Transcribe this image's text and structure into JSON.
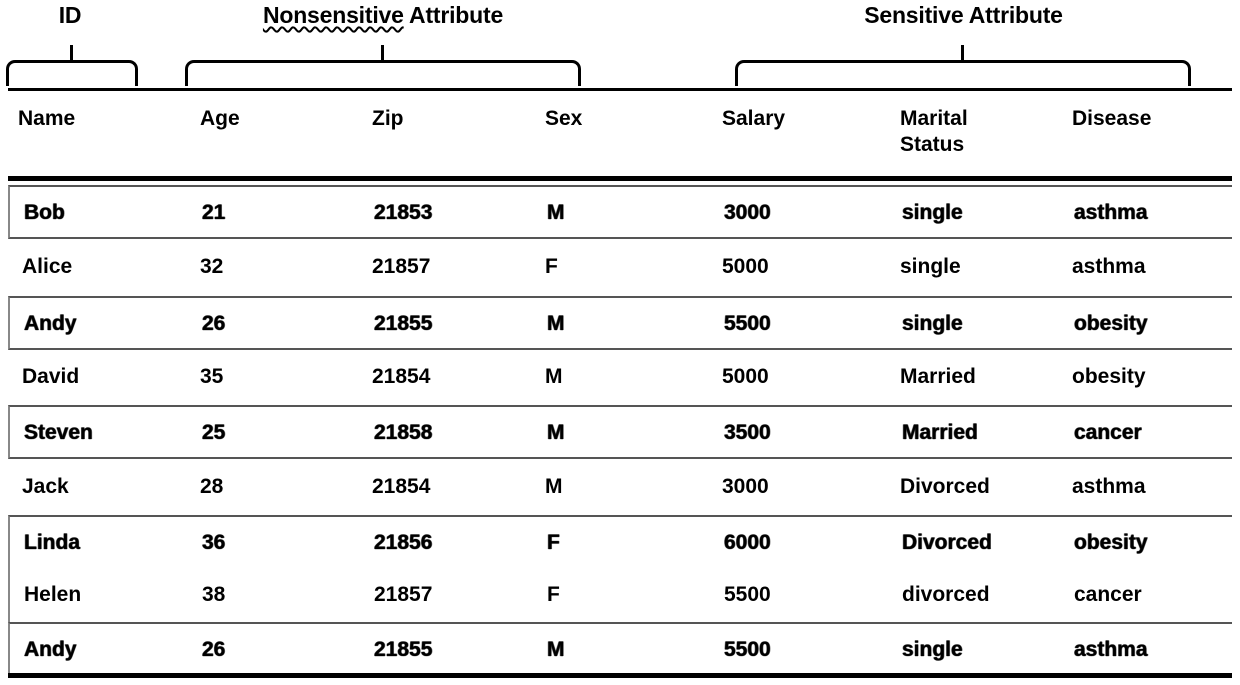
{
  "groups": [
    {
      "id": "id",
      "label": "ID",
      "underlined_word": ""
    },
    {
      "id": "nonsensitive",
      "label": "Nonsensitive Attribute",
      "underlined_word": "Nonsensitive"
    },
    {
      "id": "sensitive",
      "label": "Sensitive Attribute",
      "underlined_word": ""
    }
  ],
  "group_text": {
    "id": "ID",
    "nonsensitive_underlined": "Nonsensitive",
    "nonsensitive_rest": " Attribute",
    "sensitive": "Sensitive Attribute"
  },
  "columns": [
    {
      "key": "name",
      "label": "Name"
    },
    {
      "key": "age",
      "label": "Age"
    },
    {
      "key": "zip",
      "label": "Zip"
    },
    {
      "key": "sex",
      "label": "Sex"
    },
    {
      "key": "salary",
      "label": "Salary"
    },
    {
      "key": "marital",
      "label": "Marital\nStatus"
    },
    {
      "key": "disease",
      "label": "Disease"
    }
  ],
  "rows": [
    {
      "name": "Bob",
      "age": "21",
      "zip": "21853",
      "sex": "M",
      "salary": "3000",
      "marital": "single",
      "disease": "asthma"
    },
    {
      "name": "Alice",
      "age": "32",
      "zip": "21857",
      "sex": "F",
      "salary": "5000",
      "marital": "single",
      "disease": "asthma"
    },
    {
      "name": "Andy",
      "age": "26",
      "zip": "21855",
      "sex": "M",
      "salary": "5500",
      "marital": "single",
      "disease": "obesity"
    },
    {
      "name": "David",
      "age": "35",
      "zip": "21854",
      "sex": "M",
      "salary": "5000",
      "marital": "Married",
      "disease": "obesity"
    },
    {
      "name": "Steven",
      "age": "25",
      "zip": "21858",
      "sex": "M",
      "salary": "3500",
      "marital": "Married",
      "disease": "cancer"
    },
    {
      "name": "Jack",
      "age": "28",
      "zip": "21854",
      "sex": "M",
      "salary": "3000",
      "marital": "Divorced",
      "disease": "asthma"
    },
    {
      "name": "Linda",
      "age": "36",
      "zip": "21856",
      "sex": "F",
      "salary": "6000",
      "marital": "Divorced",
      "disease": "obesity"
    },
    {
      "name": "Helen",
      "age": "38",
      "zip": "21857",
      "sex": "F",
      "salary": "5500",
      "marital": "divorced",
      "disease": "cancer"
    },
    {
      "name": "Andy",
      "age": "26",
      "zip": "21855",
      "sex": "M",
      "salary": "5500",
      "marital": "single",
      "disease": "asthma"
    }
  ],
  "colors": {
    "ink": "#000000",
    "background": "#ffffff",
    "row_border": "#555555"
  }
}
